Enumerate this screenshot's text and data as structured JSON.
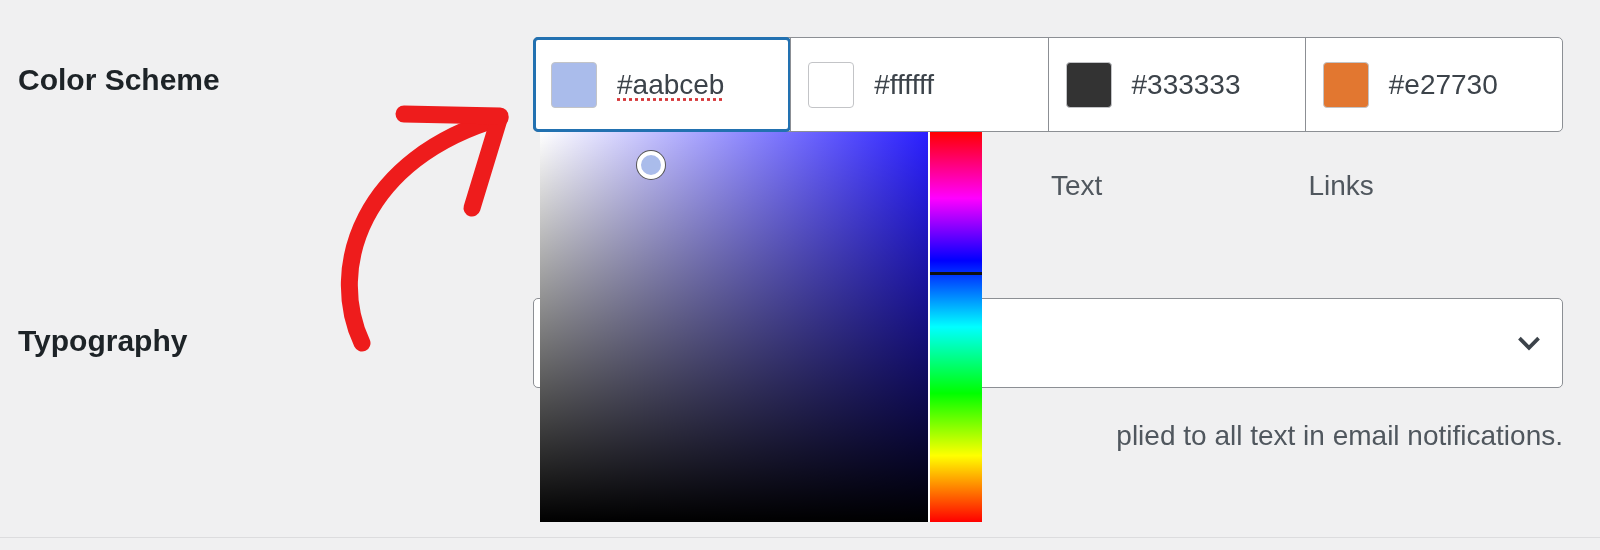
{
  "color_scheme": {
    "label": "Color Scheme",
    "swatches": [
      {
        "value": "#aabceb",
        "color": "#aabceb",
        "selected": true,
        "spellcheck": true
      },
      {
        "value": "#ffffff",
        "color": "#ffffff",
        "selected": false,
        "spellcheck": false
      },
      {
        "value": "#333333",
        "color": "#333333",
        "selected": false,
        "spellcheck": false
      },
      {
        "value": "#e27730",
        "color": "#e27730",
        "selected": false,
        "spellcheck": false
      }
    ],
    "captions": [
      "Text",
      "Links"
    ],
    "picker": {
      "open": true
    }
  },
  "typography": {
    "label": "Typography",
    "hint": "plied to all text in email notifications."
  }
}
